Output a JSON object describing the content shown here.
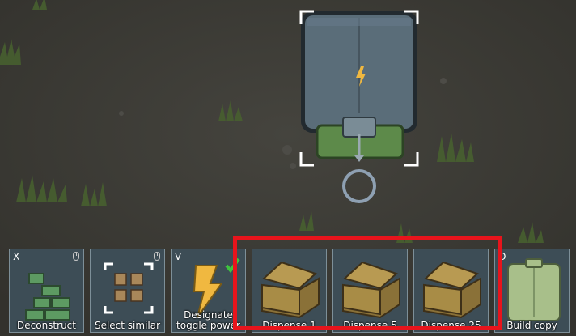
{
  "gizmos": [
    {
      "hotkey": "X",
      "label": "Deconstruct",
      "icon": "deconstruct-icon",
      "has_mouse_hint": true
    },
    {
      "hotkey": "",
      "label": "Select similar",
      "icon": "select-similar-icon",
      "has_mouse_hint": true
    },
    {
      "hotkey": "V",
      "label_line1": "Designate",
      "label_line2": "toggle power",
      "icon": "power-bolt-icon",
      "checked": true
    },
    {
      "hotkey": "",
      "label": "Dispense 1",
      "icon": "crate-icon"
    },
    {
      "hotkey": "",
      "label": "Dispense 5",
      "icon": "crate-icon"
    },
    {
      "hotkey": "",
      "label": "Dispense 25",
      "icon": "crate-icon"
    },
    {
      "hotkey": "O",
      "label": "Build copy",
      "icon": "dispenser-building-icon"
    }
  ],
  "selected_building": {
    "icon": "power-bolt-icon"
  },
  "colors": {
    "highlight": "#e8141c",
    "gizmo_bg": "#3d4d56",
    "bolt": "#f0b840",
    "building": "#5a6d79",
    "pad": "#5d8a4a"
  }
}
